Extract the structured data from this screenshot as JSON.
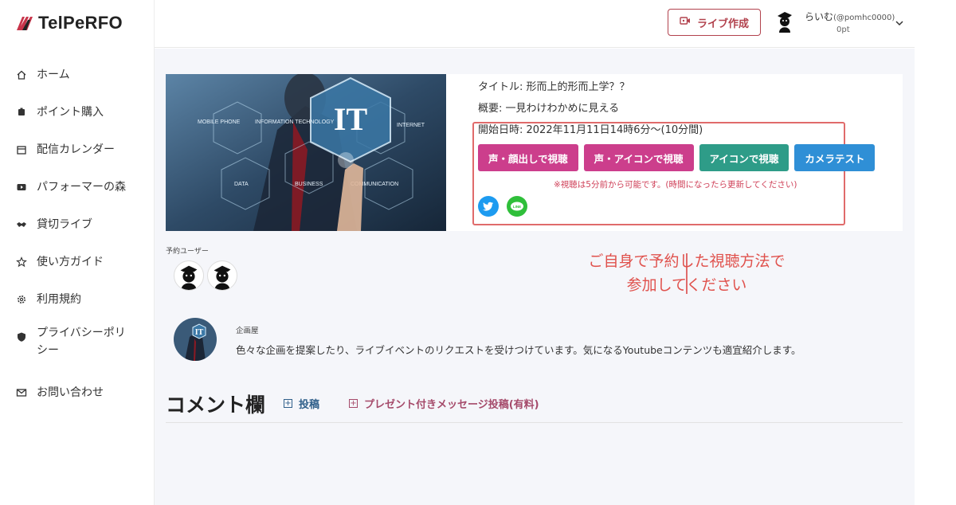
{
  "brand": {
    "logo_text": "TelPeRFO"
  },
  "sidebar": {
    "items": [
      {
        "label": "ホーム",
        "icon": "home-icon"
      },
      {
        "label": "ポイント購入",
        "icon": "points-icon"
      },
      {
        "label": "配信カレンダー",
        "icon": "calendar-icon"
      },
      {
        "label": "パフォーマーの森",
        "icon": "video-icon"
      },
      {
        "label": "貸切ライブ",
        "icon": "handshake-icon"
      },
      {
        "label": "使い方ガイド",
        "icon": "star-icon"
      },
      {
        "label": "利用規約",
        "icon": "gear-icon"
      },
      {
        "label": "プライバシーポリシー",
        "icon": "shield-icon"
      },
      {
        "label": "お問い合わせ",
        "icon": "mail-icon"
      }
    ]
  },
  "header": {
    "live_button": "ライブ作成",
    "user": {
      "name": "らいむ",
      "handle": "(@pomhc0000)",
      "points": "0pt"
    }
  },
  "event": {
    "thumbnail_text": {
      "main": "IT",
      "mobile_phone": "MOBILE PHONE",
      "information": "INFORMATION TECHNOLOGY",
      "internet": "INTERNET",
      "data": "DATA",
      "business": "BUSINESS",
      "communication": "COMMUNICATION"
    },
    "title": "タイトル: 形而上的形而上学？？",
    "summary": "概要: 一見わけわかめに見える",
    "start": "開始日時: 2022年11月11日14時6分～(10分間)",
    "buttons": [
      {
        "label": "声・顔出しで視聴",
        "color": "#cc3e8c"
      },
      {
        "label": "声・アイコンで視聴",
        "color": "#cc3e8c"
      },
      {
        "label": "アイコンで視聴",
        "color": "#2e9c88"
      },
      {
        "label": "カメラテスト",
        "color": "#2f8fd6"
      }
    ],
    "notice": "※視聴は5分前から可能です。(時間になったら更新してください)"
  },
  "annotation": {
    "line1": "ご自身で予約した視聴方法で",
    "line2": "参加してください"
  },
  "reserved": {
    "label": "予約ユーザー",
    "count": 2
  },
  "organizer": {
    "name": "企画屋",
    "description": "色々な企画を提案したり、ライブイベントのリクエストを受けつけています。気になるYoutubeコンテンツも適宜紹介します。"
  },
  "comments": {
    "heading": "コメント欄",
    "post_label": "投稿",
    "gift_label": "プレゼント付きメッセージ投稿(有料)"
  },
  "colors": {
    "accent": "#b2424d",
    "annotation": "#e06b6b"
  }
}
